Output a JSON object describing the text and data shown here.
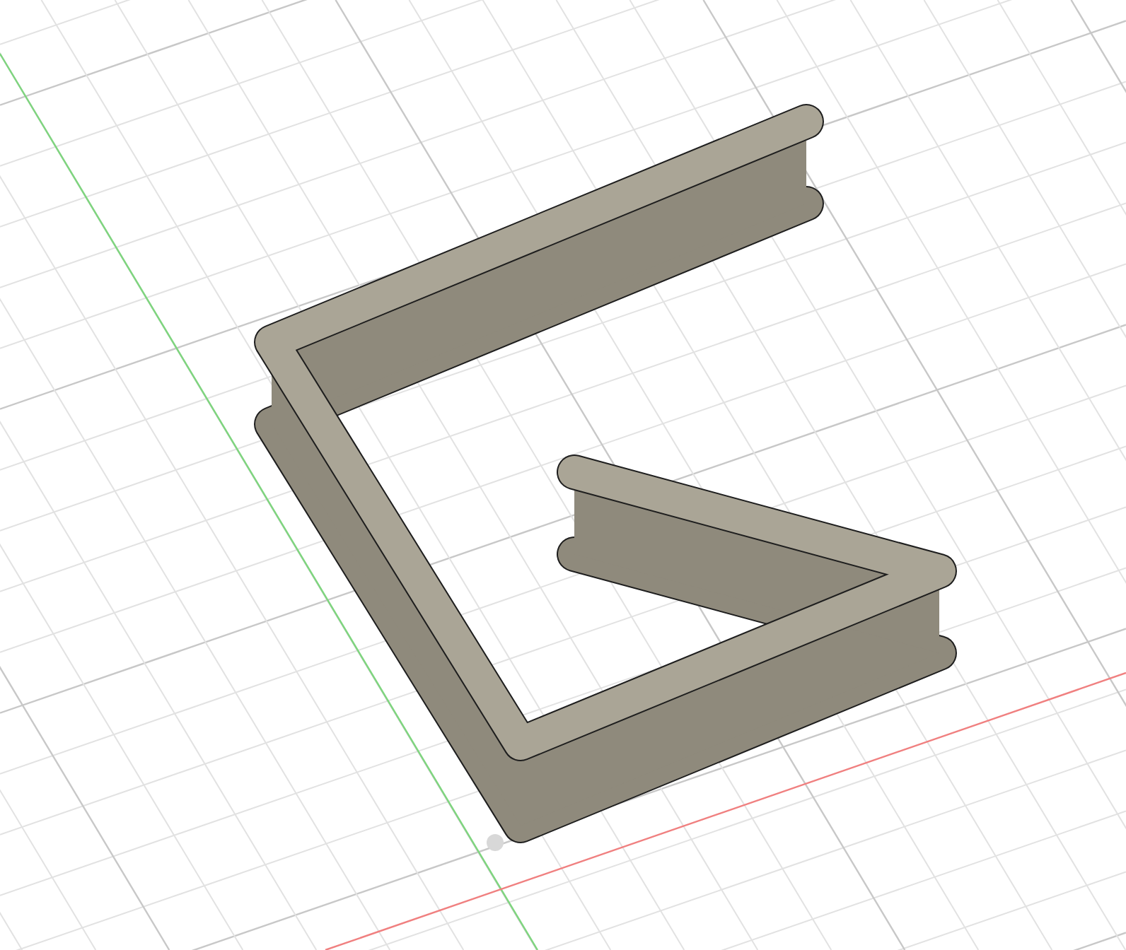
{
  "viewport": {
    "grid": true,
    "axes": true
  }
}
